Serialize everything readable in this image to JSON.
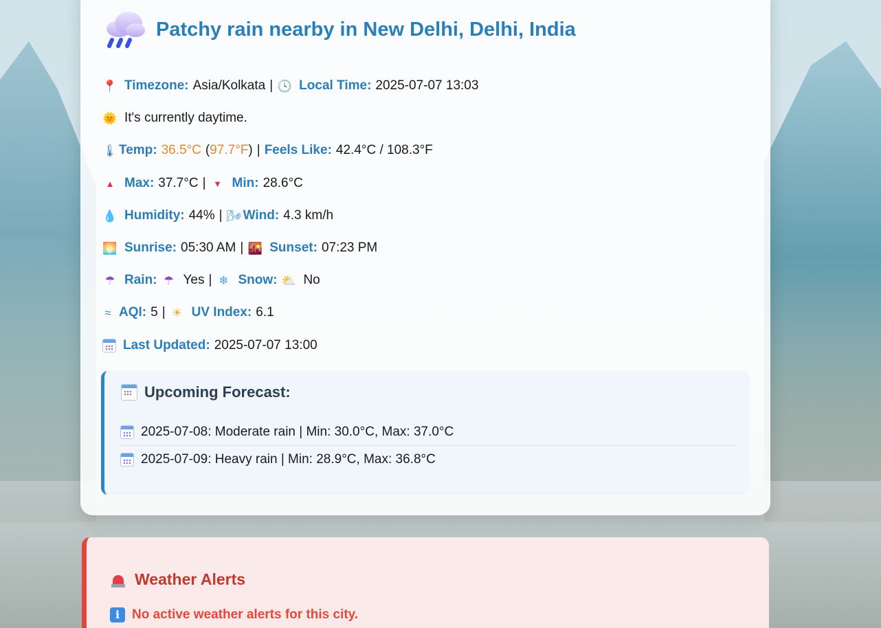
{
  "weather": {
    "title": "Patchy rain nearby in New Delhi, Delhi, India",
    "timezone_label": "Timezone:",
    "timezone_value": "Asia/Kolkata",
    "localtime_label": "Local Time:",
    "localtime_value": "2025-07-07 13:03",
    "daytime_text": "It's currently daytime.",
    "temp_label": "Temp:",
    "temp_c": "36.5°C",
    "temp_f": "97.7°F",
    "feels_label": "Feels Like:",
    "feels_value": "42.4°C / 108.3°F",
    "max_label": "Max:",
    "max_value": "37.7°C",
    "min_label": "Min:",
    "min_value": "28.6°C",
    "humidity_label": "Humidity:",
    "humidity_value": "44%",
    "wind_label": "Wind:",
    "wind_value": "4.3 km/h",
    "sunrise_label": "Sunrise:",
    "sunrise_value": "05:30 AM",
    "sunset_label": "Sunset:",
    "sunset_value": "07:23 PM",
    "rain_label": "Rain:",
    "rain_value": "Yes",
    "snow_label": "Snow:",
    "snow_value": "No",
    "aqi_label": "AQI:",
    "aqi_value": "5",
    "uv_label": "UV Index:",
    "uv_value": "6.1",
    "updated_label": "Last Updated:",
    "updated_value": "2025-07-07 13:00"
  },
  "forecast": {
    "title": "Upcoming Forecast:",
    "items": [
      "2025-07-08: Moderate rain | Min: 30.0°C, Max: 37.0°C",
      "2025-07-09: Heavy rain | Min: 28.9°C, Max: 36.8°C"
    ]
  },
  "alerts": {
    "title": "Weather Alerts",
    "message": "No active weather alerts for this city."
  },
  "colors": {
    "accent": "#2b7fb6",
    "temp_highlight": "#e6892d",
    "alert_red": "#c0392b"
  },
  "icons": {
    "condition": "rain-cloud-icon",
    "timezone": "pin-icon",
    "localtime": "clock-icon",
    "daytime": "sun-face-icon",
    "temp": "thermometer-icon",
    "max": "up-triangle-icon",
    "min": "down-triangle-icon",
    "humidity": "droplet-icon",
    "wind": "wind-icon",
    "sunrise": "sunrise-icon",
    "sunset": "sunset-icon",
    "rain": "umbrella-icon",
    "snow": "snowflake-icon",
    "snow_status": "sun-cloud-icon",
    "aqi": "fog-icon",
    "uv": "sun-icon",
    "updated": "calendar-icon",
    "alert": "siren-icon",
    "info": "info-icon"
  }
}
